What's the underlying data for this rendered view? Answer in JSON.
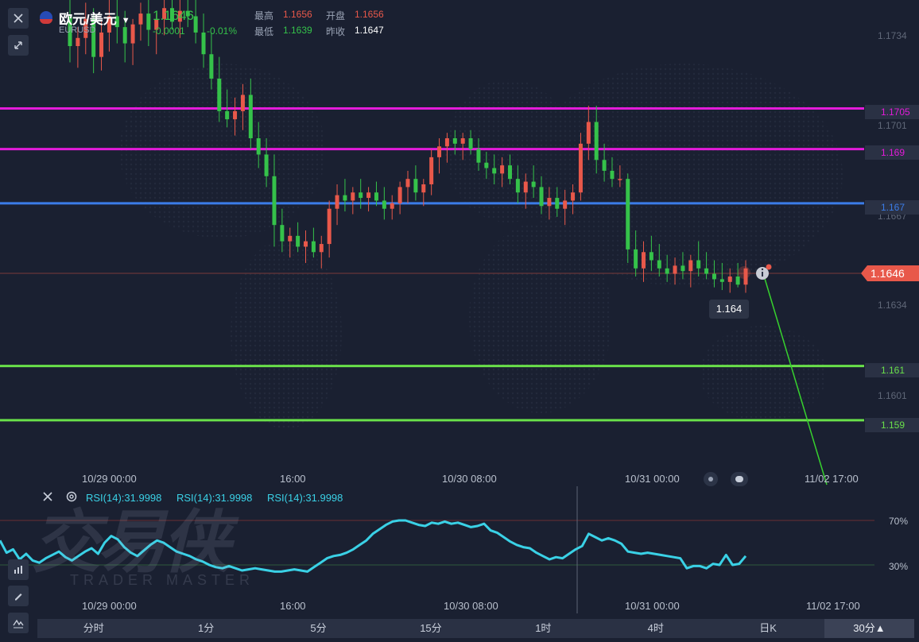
{
  "header": {
    "close_icon": "close-icon",
    "collapse_icon": "collapse-arrows-icon",
    "flag_icon": "eu-flag-icon",
    "title": "欧元/美元",
    "symbol": "EURUSD",
    "price": "1.1646",
    "change": "-0.0001",
    "change_pct": "-0.01%",
    "high_label": "最高",
    "high_value": "1.1656",
    "open_label": "开盘",
    "open_value": "1.1656",
    "low_label": "最低",
    "low_value": "1.1639",
    "prev_label": "昨收",
    "prev_value": "1.1647"
  },
  "price_axis": {
    "ticks": [
      "1.1734",
      "1.1701",
      "1.1667",
      "1.1634",
      "1.1601"
    ],
    "current_tag": "1.1646",
    "cursor_label": "1.164"
  },
  "levels": [
    {
      "value": "1.1705",
      "color": "#e31bd9"
    },
    {
      "value": "1.169",
      "color": "#e31bd9"
    },
    {
      "value": "1.167",
      "color": "#3b7ce8"
    },
    {
      "value": "1.161",
      "color": "#69e04a"
    },
    {
      "value": "1.159",
      "color": "#69e04a"
    }
  ],
  "time_axis": {
    "main": [
      "10/29 00:00",
      "16:00",
      "10/30 08:00",
      "10/31 00:00",
      "11/02 17:00"
    ],
    "rsi": [
      "10/29 00:00",
      "16:00",
      "10/30 08:00",
      "10/31 00:00",
      "11/02 17:00"
    ]
  },
  "rsi": {
    "labels": [
      "RSI(14):31.9998",
      "RSI(14):31.9998",
      "RSI(14):31.9998"
    ],
    "level_high": "70%",
    "level_low": "30%",
    "color": "#3ad1e6"
  },
  "watermark": {
    "cn": "交易侠",
    "en": "TRADER MASTER"
  },
  "timeframes": [
    "分时",
    "1分",
    "5分",
    "15分",
    "1时",
    "4时",
    "日K",
    "30分▲"
  ],
  "timeframe_active": "30分▲",
  "colors": {
    "up": "#e8584a",
    "down": "#35c24a",
    "background": "#1a2031",
    "projection": "#37d22e"
  },
  "chart_data": {
    "type": "candlestick",
    "symbol": "EURUSD",
    "ylim": [
      1.1575,
      1.1745
    ],
    "candles": [
      [
        1.1739,
        1.1746,
        1.1722,
        1.1728
      ],
      [
        1.1728,
        1.1735,
        1.172,
        1.1731
      ],
      [
        1.1731,
        1.1744,
        1.1725,
        1.1738
      ],
      [
        1.1738,
        1.1742,
        1.1718,
        1.1724
      ],
      [
        1.1724,
        1.1737,
        1.1719,
        1.1733
      ],
      [
        1.1733,
        1.1745,
        1.1726,
        1.1739
      ],
      [
        1.1739,
        1.1746,
        1.1729,
        1.1735
      ],
      [
        1.1735,
        1.1741,
        1.1722,
        1.1729
      ],
      [
        1.1729,
        1.1738,
        1.1721,
        1.1736
      ],
      [
        1.1736,
        1.1744,
        1.173,
        1.174
      ],
      [
        1.174,
        1.1746,
        1.1728,
        1.1734
      ],
      [
        1.1734,
        1.174,
        1.1725,
        1.1738
      ],
      [
        1.1738,
        1.1746,
        1.1732,
        1.1742
      ],
      [
        1.1742,
        1.1746,
        1.1734,
        1.1737
      ],
      [
        1.1737,
        1.1746,
        1.1731,
        1.1741
      ],
      [
        1.1741,
        1.1746,
        1.1735,
        1.1739
      ],
      [
        1.1739,
        1.1745,
        1.1729,
        1.1733
      ],
      [
        1.1733,
        1.174,
        1.172,
        1.1725
      ],
      [
        1.1725,
        1.1733,
        1.1712,
        1.1716
      ],
      [
        1.1716,
        1.1724,
        1.17,
        1.1704
      ],
      [
        1.1704,
        1.1712,
        1.1698,
        1.1701
      ],
      [
        1.1701,
        1.1709,
        1.1695,
        1.1704
      ],
      [
        1.1704,
        1.1714,
        1.1697,
        1.171
      ],
      [
        1.171,
        1.1716,
        1.169,
        1.1694
      ],
      [
        1.1694,
        1.17,
        1.1683,
        1.1688
      ],
      [
        1.1688,
        1.1694,
        1.1676,
        1.168
      ],
      [
        1.168,
        1.1688,
        1.1654,
        1.1662
      ],
      [
        1.1662,
        1.1668,
        1.1652,
        1.1656
      ],
      [
        1.1656,
        1.1661,
        1.165,
        1.1658
      ],
      [
        1.1658,
        1.1663,
        1.1652,
        1.1654
      ],
      [
        1.1654,
        1.166,
        1.1648,
        1.1656
      ],
      [
        1.1656,
        1.1661,
        1.165,
        1.1652
      ],
      [
        1.1652,
        1.1658,
        1.1646,
        1.1655
      ],
      [
        1.1655,
        1.1671,
        1.165,
        1.1668
      ],
      [
        1.1668,
        1.1677,
        1.1662,
        1.1673
      ],
      [
        1.1673,
        1.1679,
        1.1667,
        1.1671
      ],
      [
        1.1671,
        1.1676,
        1.1666,
        1.1674
      ],
      [
        1.1674,
        1.1679,
        1.1668,
        1.1672
      ],
      [
        1.1672,
        1.1676,
        1.1667,
        1.1674
      ],
      [
        1.1674,
        1.1678,
        1.1669,
        1.1671
      ],
      [
        1.1671,
        1.1676,
        1.1664,
        1.1668
      ],
      [
        1.1668,
        1.1673,
        1.1664,
        1.167
      ],
      [
        1.167,
        1.1678,
        1.1666,
        1.1676
      ],
      [
        1.1676,
        1.1682,
        1.167,
        1.1679
      ],
      [
        1.1679,
        1.1684,
        1.1671,
        1.1674
      ],
      [
        1.1674,
        1.1679,
        1.1669,
        1.1677
      ],
      [
        1.1677,
        1.169,
        1.1673,
        1.1687
      ],
      [
        1.1687,
        1.1694,
        1.1681,
        1.1691
      ],
      [
        1.1691,
        1.1696,
        1.1685,
        1.1694
      ],
      [
        1.1694,
        1.1697,
        1.1688,
        1.1692
      ],
      [
        1.1692,
        1.1696,
        1.1686,
        1.1694
      ],
      [
        1.1694,
        1.1697,
        1.1688,
        1.169
      ],
      [
        1.169,
        1.1694,
        1.1682,
        1.1685
      ],
      [
        1.1685,
        1.1689,
        1.1679,
        1.1683
      ],
      [
        1.1683,
        1.1688,
        1.1677,
        1.1681
      ],
      [
        1.1681,
        1.1687,
        1.1676,
        1.1684
      ],
      [
        1.1684,
        1.1688,
        1.1677,
        1.1679
      ],
      [
        1.1679,
        1.1684,
        1.167,
        1.1674
      ],
      [
        1.1674,
        1.1681,
        1.1668,
        1.1678
      ],
      [
        1.1678,
        1.1684,
        1.1672,
        1.1676
      ],
      [
        1.1676,
        1.168,
        1.1666,
        1.1669
      ],
      [
        1.1669,
        1.1676,
        1.1664,
        1.1672
      ],
      [
        1.1672,
        1.1676,
        1.1665,
        1.1668
      ],
      [
        1.1668,
        1.1675,
        1.1662,
        1.1671
      ],
      [
        1.1671,
        1.1677,
        1.1666,
        1.1674
      ],
      [
        1.1674,
        1.1696,
        1.1671,
        1.1692
      ],
      [
        1.1692,
        1.1706,
        1.1686,
        1.17
      ],
      [
        1.17,
        1.1706,
        1.1681,
        1.1686
      ],
      [
        1.1686,
        1.1692,
        1.1678,
        1.1682
      ],
      [
        1.1682,
        1.1687,
        1.1676,
        1.1679
      ],
      [
        1.1679,
        1.1684,
        1.1676,
        1.1679
      ],
      [
        1.1679,
        1.1681,
        1.1648,
        1.1653
      ],
      [
        1.1653,
        1.166,
        1.1643,
        1.1646
      ],
      [
        1.1646,
        1.1656,
        1.1641,
        1.1652
      ],
      [
        1.1652,
        1.1658,
        1.1645,
        1.1649
      ],
      [
        1.1649,
        1.1655,
        1.1643,
        1.1646
      ],
      [
        1.1646,
        1.1651,
        1.1641,
        1.1644
      ],
      [
        1.1644,
        1.165,
        1.164,
        1.1647
      ],
      [
        1.1647,
        1.1652,
        1.1642,
        1.1645
      ],
      [
        1.1645,
        1.1651,
        1.1639,
        1.1649
      ],
      [
        1.1649,
        1.1656,
        1.1643,
        1.1646
      ],
      [
        1.1646,
        1.1652,
        1.1642,
        1.1644
      ],
      [
        1.1644,
        1.1649,
        1.1639,
        1.1642
      ],
      [
        1.1642,
        1.1648,
        1.1638,
        1.1641
      ],
      [
        1.1641,
        1.1646,
        1.1637,
        1.1643
      ],
      [
        1.1643,
        1.1648,
        1.1639,
        1.164
      ],
      [
        1.164,
        1.1649,
        1.1637,
        1.1646
      ]
    ],
    "rsi_values": [
      52,
      41,
      44,
      35,
      40,
      34,
      32,
      36,
      39,
      42,
      37,
      34,
      38,
      42,
      45,
      40,
      50,
      56,
      53,
      46,
      41,
      38,
      43,
      48,
      52,
      50,
      46,
      42,
      40,
      38,
      35,
      33,
      30,
      28,
      27,
      29,
      27,
      25,
      26,
      27,
      26,
      25,
      24,
      24,
      25,
      26,
      25,
      24,
      28,
      32,
      36,
      38,
      39,
      41,
      44,
      48,
      52,
      58,
      62,
      66,
      69,
      70,
      70,
      68,
      66,
      65,
      68,
      67,
      69,
      67,
      68,
      66,
      64,
      65,
      67,
      61,
      59,
      55,
      51,
      48,
      46,
      45,
      41,
      38,
      35,
      37,
      36,
      40,
      44,
      47,
      58,
      55,
      52,
      54,
      52,
      49,
      42,
      41,
      40,
      41,
      40,
      39,
      38,
      37,
      36,
      27,
      29,
      29,
      27,
      31,
      30,
      39,
      30,
      31,
      38
    ]
  }
}
